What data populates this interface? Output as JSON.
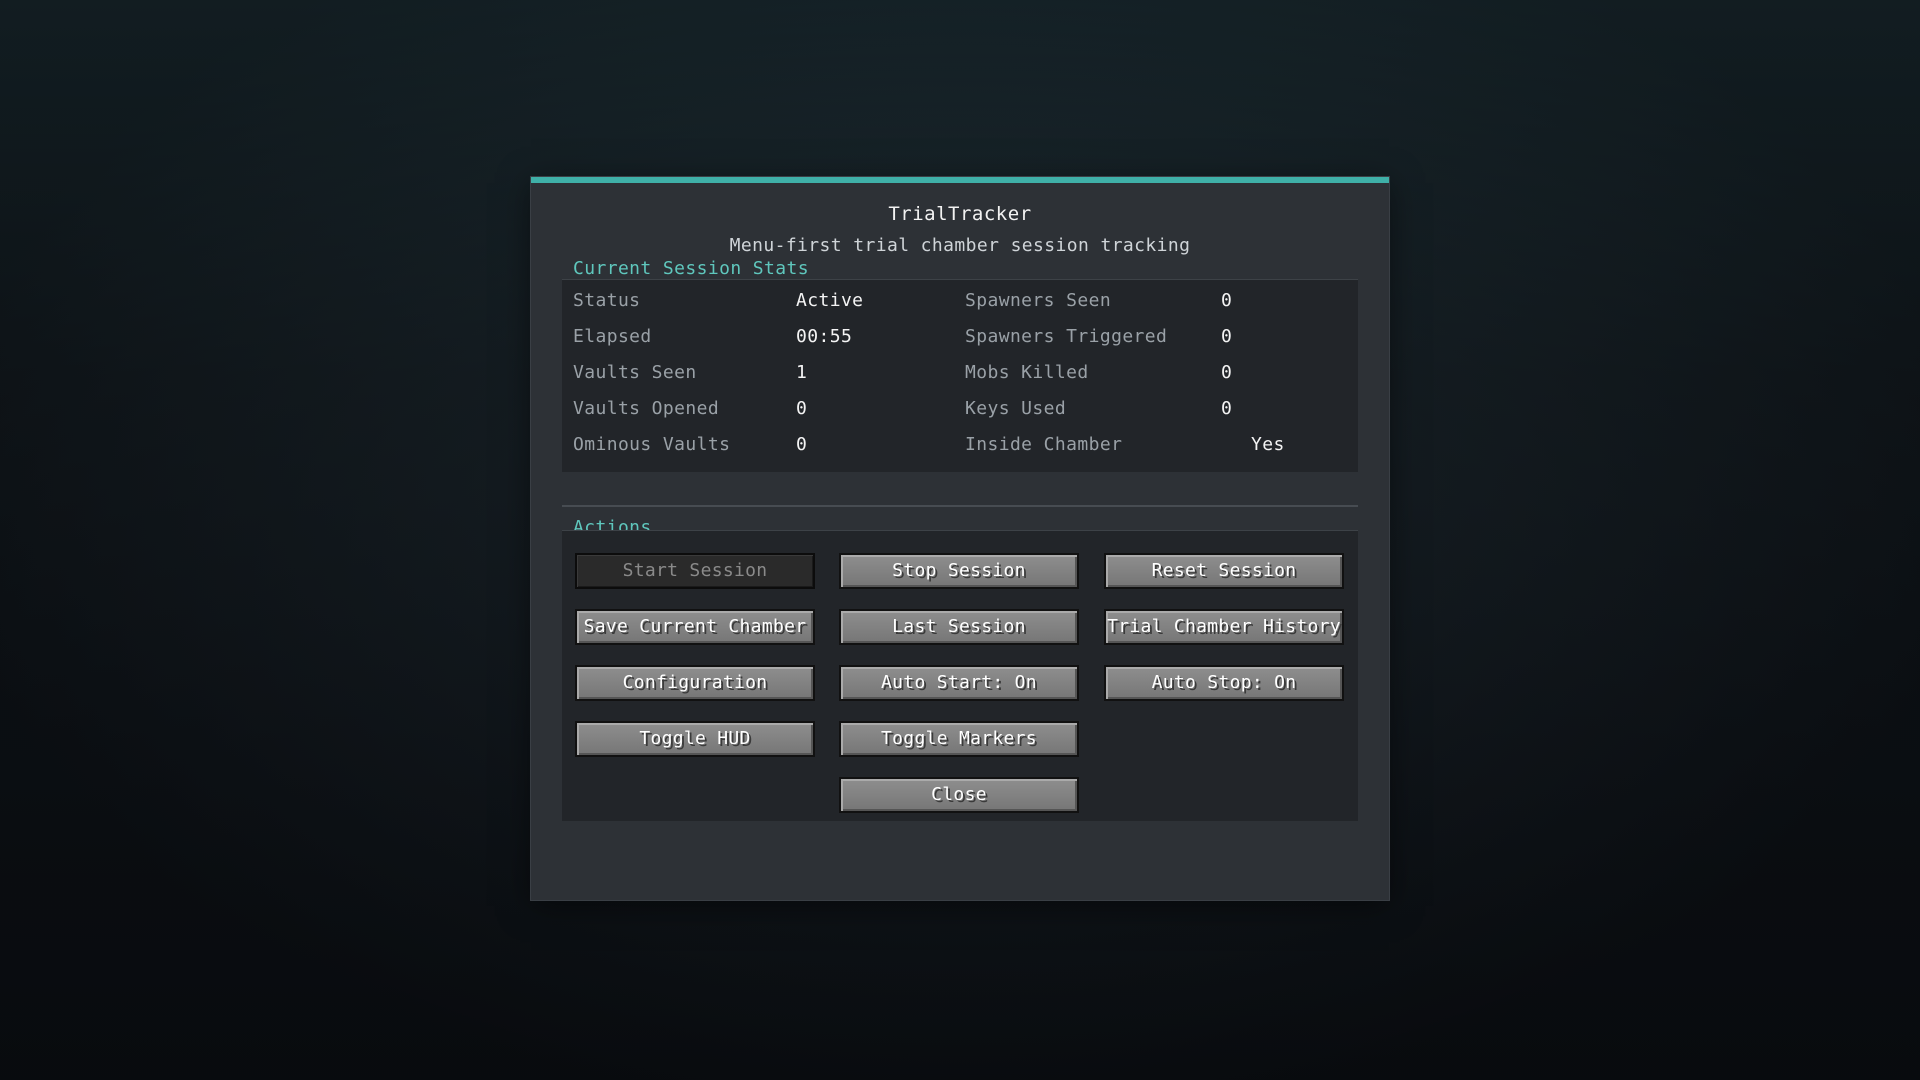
{
  "header": {
    "title": "TrialTracker",
    "subtitle": "Menu-first trial chamber session tracking"
  },
  "stats": {
    "section_label": "Current Session Stats",
    "left": [
      {
        "label": "Status",
        "value": "Active"
      },
      {
        "label": "Elapsed",
        "value": "00:55"
      },
      {
        "label": "Vaults Seen",
        "value": "1"
      },
      {
        "label": "Vaults Opened",
        "value": "0"
      },
      {
        "label": "Ominous Vaults",
        "value": "0"
      }
    ],
    "right": [
      {
        "label": "Spawners Seen",
        "value": "0"
      },
      {
        "label": "Spawners Triggered",
        "value": "0"
      },
      {
        "label": "Mobs Killed",
        "value": "0"
      },
      {
        "label": "Keys Used",
        "value": "0"
      },
      {
        "label": "Inside Chamber",
        "value": "Yes"
      }
    ]
  },
  "actions": {
    "section_label": "Actions",
    "start_session": "Start Session",
    "stop_session": "Stop Session",
    "reset_session": "Reset Session",
    "save_current_chamber": "Save Current Chamber",
    "last_session": "Last Session",
    "trial_chamber_history": "Trial Chamber History",
    "configuration": "Configuration",
    "auto_start": "Auto Start: On",
    "auto_stop": "Auto Stop: On",
    "toggle_hud": "Toggle HUD",
    "toggle_markers": "Toggle Markers",
    "close": "Close"
  },
  "colors": {
    "accent": "#3fb0a8",
    "section_label": "#5fc7bd",
    "panel_bg": "#2d3136",
    "inner_bg": "#222529"
  }
}
